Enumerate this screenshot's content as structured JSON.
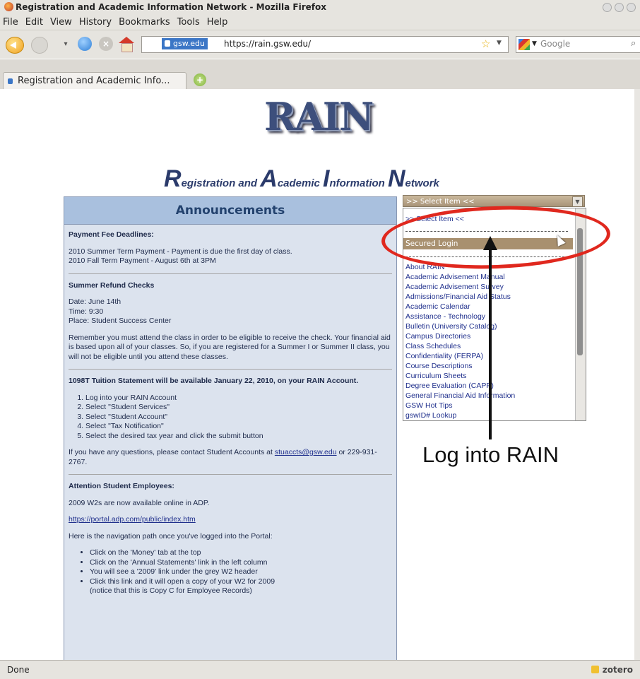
{
  "window": {
    "title": "Registration and Academic Information Network - Mozilla Firefox"
  },
  "menu": [
    "File",
    "Edit",
    "View",
    "History",
    "Bookmarks",
    "Tools",
    "Help"
  ],
  "navbar": {
    "site_identity": "gsw.edu",
    "url": "https://rain.gsw.edu/",
    "search_placeholder": "Google"
  },
  "tab": {
    "label": "Registration and Academic Info..."
  },
  "page": {
    "logo_text": "RAIN",
    "title_parts": [
      "R",
      "egistration and ",
      "A",
      "cademic ",
      "I",
      "nformation ",
      "N",
      "etwork"
    ],
    "announcements": {
      "heading": "Announcements",
      "payment": {
        "heading": "Payment Fee Deadlines:",
        "line1": "2010 Summer Term Payment - Payment is due the first day of class.",
        "line2": "2010 Fall Term Payment - August 6th at 3PM"
      },
      "refund": {
        "heading": "Summer Refund Checks",
        "date": "Date:  June 14th",
        "time": "Time:  9:30",
        "place": "Place:  Student Success Center",
        "note": "Remember you must attend the class in order to be eligible to receive the check. Your financial aid is based upon all of your classes. So, if you are registered for a Summer I or Summer II class, you will not be eligible until you attend these classes."
      },
      "tuition": {
        "heading": "1098T Tuition Statement will be available January 22, 2010, on your RAIN Account.",
        "steps": [
          "Log into your RAIN Account",
          "Select \"Student Services\"",
          "Select \"Student Account\"",
          "Select \"Tax Notification\"",
          "Select the desired tax year and click the submit button"
        ],
        "contact_prefix": "If you have any questions, please contact Student Accounts at ",
        "contact_email": "stuaccts@gsw.edu",
        "contact_suffix": " or 229-931-2767."
      },
      "employees": {
        "heading": "Attention Student Employees:",
        "w2": "2009 W2s are now available online in ADP.",
        "link": "https://portal.adp.com/public/index.htm",
        "path_intro": "Here is the navigation path once you've logged into the Portal:",
        "bullets": [
          "Click on the 'Money' tab at the top",
          "Click on the 'Annual Statements' link in the left column",
          "You will see a '2009' link under the grey W2 header",
          "Click this link and it will open a copy of your W2 for 2009",
          "(notice that this is Copy C for Employee Records)"
        ]
      }
    },
    "select": {
      "selected": ">> Select Item <<",
      "first_option": ">> Select Item <<",
      "highlighted": "Secured Login",
      "options": [
        "About RAIN",
        "Academic Advisement Manual",
        "Academic Advisement Survey",
        "Admissions/Financial Aid Status",
        "Academic Calendar",
        "Assistance - Technology",
        "Bulletin (University Catalog)",
        "Campus Directories",
        "Class Schedules",
        "Confidentiality (FERPA)",
        "Course Descriptions",
        "Curriculum Sheets",
        "Degree Evaluation (CAPP)",
        "General Financial Aid Information",
        "GSW Hot Tips",
        "gswID# Lookup"
      ]
    },
    "annotation": "Log into RAIN"
  },
  "status": {
    "text": "Done",
    "addon": "zotero"
  },
  "colors": {
    "annotation_red": "#e0281e",
    "announcement_header": "#a9c0de",
    "selection_highlight": "#a8906f"
  }
}
